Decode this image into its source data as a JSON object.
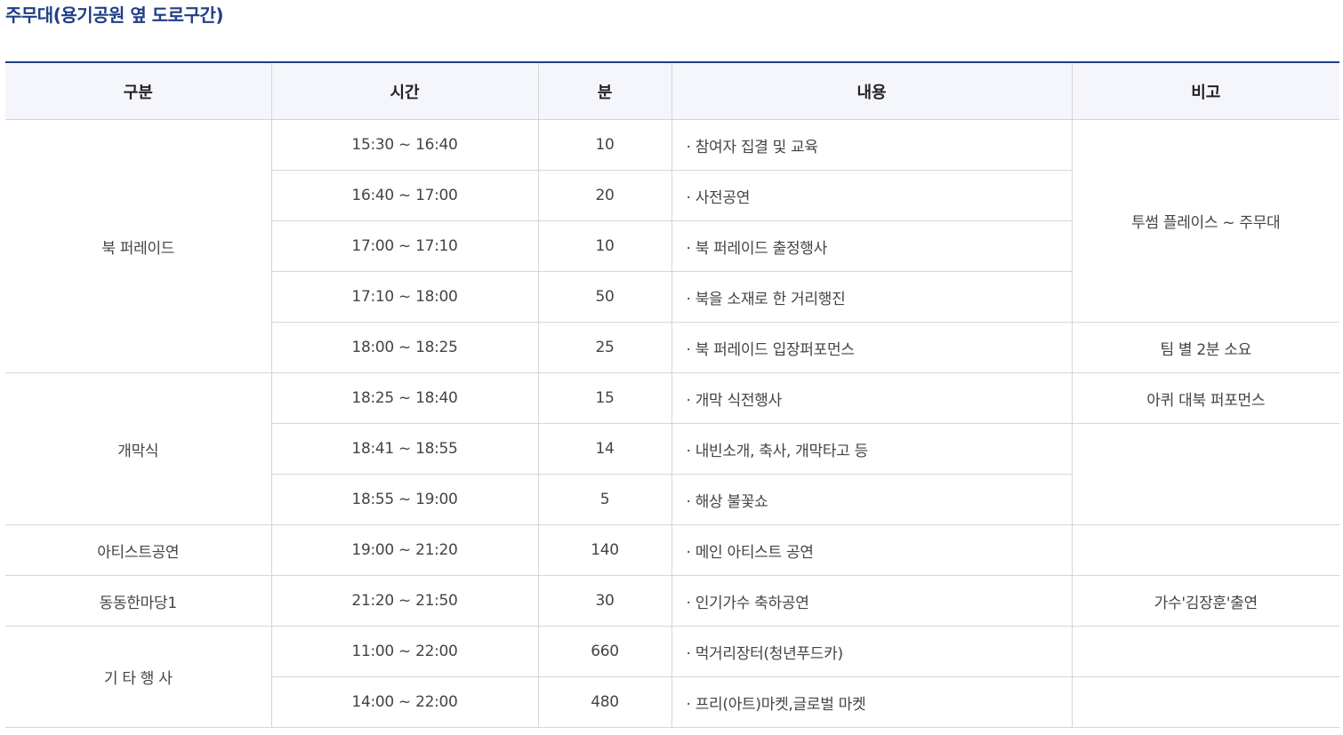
{
  "title": "주무대(용기공원 옆 도로구간)",
  "headers": [
    "구분",
    "시간",
    "분",
    "내용",
    "비고"
  ],
  "categories": [
    "북 퍼레이드",
    "개막식",
    "아티스트공연",
    "동동한마당1",
    "기 타 행 사"
  ],
  "rows": [
    {
      "time": "15:30 ~ 16:40",
      "minutes": "10",
      "content": "· 참여자 집결 및 교육"
    },
    {
      "time": "16:40 ~ 17:00",
      "minutes": "20",
      "content": "· 사전공연"
    },
    {
      "time": "17:00 ~ 17:10",
      "minutes": "10",
      "content": "· 북 퍼레이드 출정행사"
    },
    {
      "time": "17:10 ~ 18:00",
      "minutes": "50",
      "content": "· 북을 소재로 한 거리행진"
    },
    {
      "time": "18:00 ~ 18:25",
      "minutes": "25",
      "content": "· 북 퍼레이드 입장퍼포먼스"
    },
    {
      "time": "18:25 ~ 18:40",
      "minutes": "15",
      "content": "· 개막 식전행사"
    },
    {
      "time": "18:41 ~ 18:55",
      "minutes": "14",
      "content": "· 내빈소개, 축사, 개막타고 등"
    },
    {
      "time": "18:55 ~ 19:00",
      "minutes": "5",
      "content": "· 해상 불꽃쇼"
    },
    {
      "time": "19:00 ~ 21:20",
      "minutes": "140",
      "content": "· 메인 아티스트 공연"
    },
    {
      "time": "21:20 ~ 21:50",
      "minutes": "30",
      "content": "· 인기가수 축하공연"
    },
    {
      "time": "11:00 ~ 22:00",
      "minutes": "660",
      "content": "· 먹거리장터(청년푸드카)"
    },
    {
      "time": "14:00 ~ 22:00",
      "minutes": "480",
      "content": "· 프리(아트)마켓,글로벌 마켓"
    }
  ],
  "notes": [
    "투썸 플레이스 ~ 주무대",
    "팀 별 2분 소요",
    "아퀴 대북 퍼포먼스",
    "",
    "",
    "가수'김장훈'출연",
    "",
    ""
  ]
}
